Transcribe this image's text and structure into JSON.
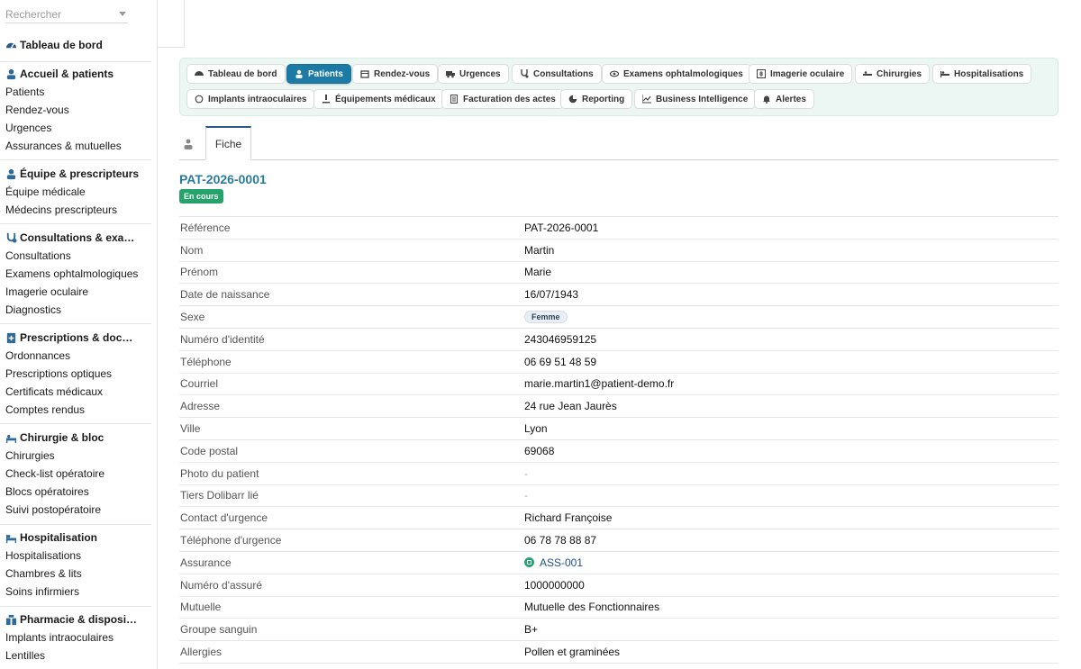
{
  "search": {
    "placeholder": "Rechercher"
  },
  "sidebar": {
    "dashboard_label": "Tableau de bord",
    "groups": [
      {
        "title": "Accueil & patients",
        "items": [
          "Patients",
          "Rendez-vous",
          "Urgences",
          "Assurances & mutuelles"
        ]
      },
      {
        "title": "Équipe & prescripteurs",
        "items": [
          "Équipe médicale",
          "Médecins prescripteurs"
        ]
      },
      {
        "title": "Consultations & exa…",
        "items": [
          "Consultations",
          "Examens ophtalmologiques",
          "Imagerie oculaire",
          "Diagnostics"
        ]
      },
      {
        "title": "Prescriptions & doc…",
        "items": [
          "Ordonnances",
          "Prescriptions optiques",
          "Certificats médicaux",
          "Comptes rendus"
        ]
      },
      {
        "title": "Chirurgie & bloc",
        "items": [
          "Chirurgies",
          "Check-list opératoire",
          "Blocs opératoires",
          "Suivi postopératoire"
        ]
      },
      {
        "title": "Hospitalisation",
        "items": [
          "Hospitalisations",
          "Chambres & lits",
          "Soins infirmiers"
        ]
      },
      {
        "title": "Pharmacie & disposi…",
        "items": [
          "Implants intraoculaires",
          "Lentilles"
        ]
      }
    ]
  },
  "tabs": [
    {
      "label": "Tableau de bord",
      "icon": "gauge-icon"
    },
    {
      "label": "Patients",
      "icon": "patient-icon",
      "active": true
    },
    {
      "label": "Rendez-vous",
      "icon": "calendar-icon"
    },
    {
      "label": "Urgences",
      "icon": "ambulance-icon"
    },
    {
      "label": "Consultations",
      "icon": "stethoscope-icon"
    },
    {
      "label": "Examens ophtalmologiques",
      "icon": "eye-icon"
    },
    {
      "label": "Imagerie oculaire",
      "icon": "xray-icon"
    },
    {
      "label": "Chirurgies",
      "icon": "surgery-bed-icon"
    },
    {
      "label": "Hospitalisations",
      "icon": "bed-icon"
    },
    {
      "label": "Implants intraoculaires",
      "icon": "circle-icon"
    },
    {
      "label": "Équipements médicaux",
      "icon": "microscope-icon"
    },
    {
      "label": "Facturation des actes",
      "icon": "invoice-icon"
    },
    {
      "label": "Reporting",
      "icon": "pie-chart-icon"
    },
    {
      "label": "Business Intelligence",
      "icon": "line-chart-icon"
    },
    {
      "label": "Alertes",
      "icon": "bell-icon"
    }
  ],
  "subtabs": {
    "fiche_label": "Fiche"
  },
  "record": {
    "ref": "PAT-2026-0001",
    "status": "En cours",
    "fields": [
      {
        "label": "Référence",
        "value": "PAT-2026-0001"
      },
      {
        "label": "Nom",
        "value": "Martin"
      },
      {
        "label": "Prénom",
        "value": "Marie"
      },
      {
        "label": "Date de naissance",
        "value": "16/07/1943"
      },
      {
        "label": "Sexe",
        "value": "Femme"
      },
      {
        "label": "Numéro d'identité",
        "value": "243046959125"
      },
      {
        "label": "Téléphone",
        "value": "06 69 51 48 59"
      },
      {
        "label": "Courriel",
        "value": "marie.martin1@patient-demo.fr"
      },
      {
        "label": "Adresse",
        "value": "24 rue Jean Jaurès"
      },
      {
        "label": "Ville",
        "value": "Lyon"
      },
      {
        "label": "Code postal",
        "value": "69068"
      },
      {
        "label": "Photo du patient",
        "value": "-"
      },
      {
        "label": "Tiers Dolibarr lié",
        "value": "-"
      },
      {
        "label": "Contact d'urgence",
        "value": "Richard Françoise"
      },
      {
        "label": "Téléphone d'urgence",
        "value": "06 78 78 88 87"
      },
      {
        "label": "Assurance",
        "value": "ASS-001"
      },
      {
        "label": "Numéro d'assuré",
        "value": "1000000000"
      },
      {
        "label": "Mutuelle",
        "value": "Mutuelle des Fonctionnaires"
      },
      {
        "label": "Groupe sanguin",
        "value": "B+"
      },
      {
        "label": "Allergies",
        "value": "Pollen et graminées"
      }
    ]
  },
  "colors": {
    "accent": "#1b7ba4",
    "status_green": "#26a36a",
    "tabs_bg": "#ecf6f3",
    "ref_color": "#2a7aa0"
  }
}
